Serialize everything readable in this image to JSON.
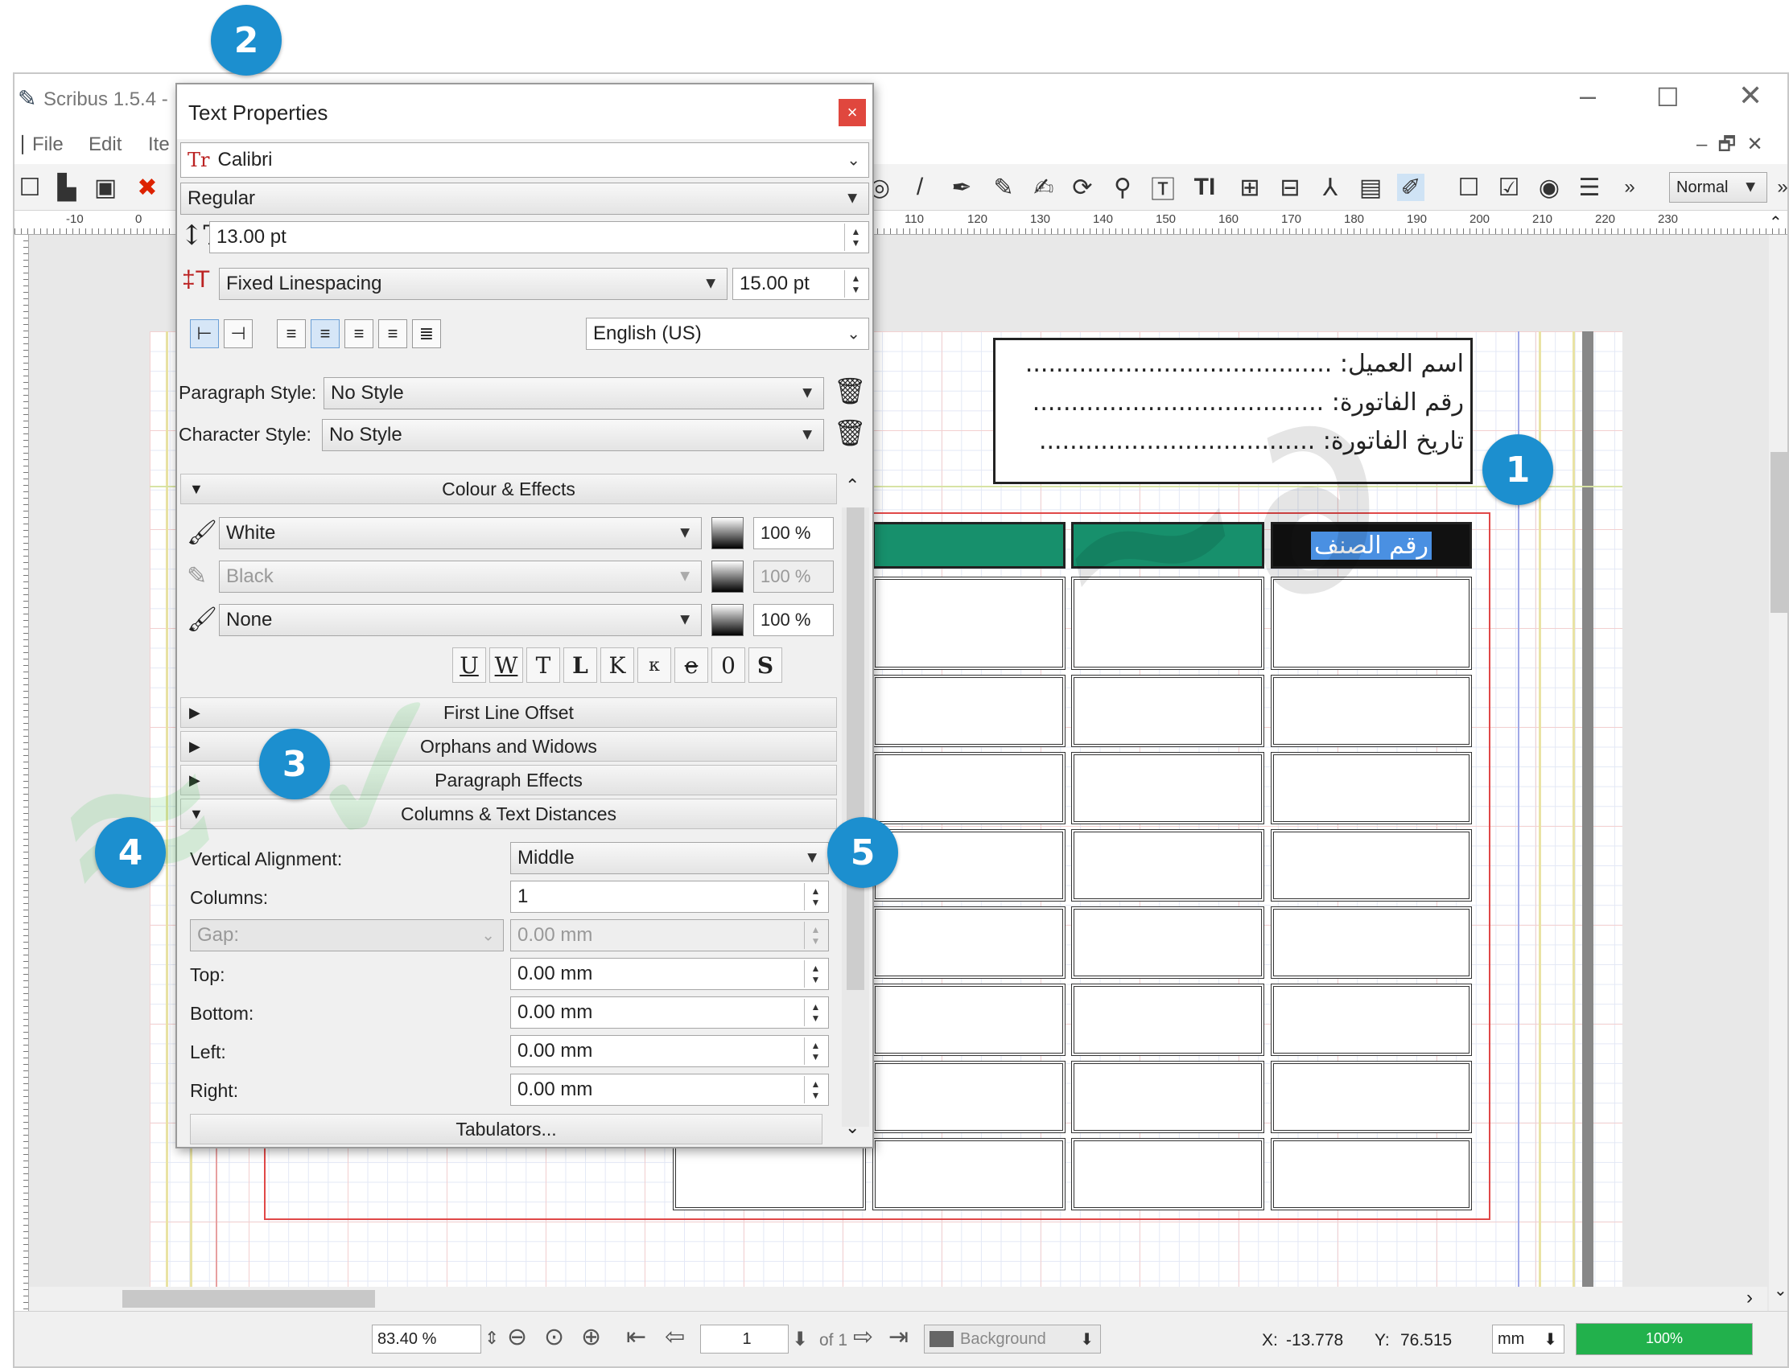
{
  "window": {
    "title": "Scribus 1.5.4 -"
  },
  "menu": {
    "file": "File",
    "edit": "Edit",
    "item": "Ite"
  },
  "toolbar": {
    "mode": "Normal"
  },
  "ruler": {
    "ticks": [
      "-10",
      "0",
      "110",
      "120",
      "130",
      "140",
      "150",
      "160",
      "170",
      "180",
      "190",
      "200",
      "210",
      "220",
      "230"
    ]
  },
  "document": {
    "info_lines": [
      "اسم العميل: ........................................",
      "رقم الفاتورة: ......................................",
      "تاريخ الفاتورة: ...................................."
    ],
    "selected_cell_text": "رقم الصنف"
  },
  "palette": {
    "title": "Text Properties",
    "close": "×",
    "font_family": "Calibri",
    "font_style": "Regular",
    "font_size": "13.00 pt",
    "linespacing_mode": "Fixed Linespacing",
    "linespacing_value": "15.00 pt",
    "language": "English (US)",
    "paragraph_style_label": "Paragraph Style:",
    "paragraph_style_value": "No Style",
    "character_style_label": "Character Style:",
    "character_style_value": "No Style",
    "sections": {
      "colour_effects": "Colour & Effects",
      "first_line_offset": "First Line Offset",
      "orphans_widows": "Orphans and Widows",
      "paragraph_effects": "Paragraph Effects",
      "columns_distances": "Columns & Text Distances"
    },
    "colours": [
      {
        "name": "White",
        "shade": "100 %"
      },
      {
        "name": "Black",
        "shade": "100 %"
      },
      {
        "name": "None",
        "shade": "100 %"
      }
    ],
    "effects": [
      "U",
      "W",
      "T",
      "L",
      "K",
      "κ",
      "e",
      "0",
      "S"
    ],
    "columns": {
      "vertical_alignment_label": "Vertical Alignment:",
      "vertical_alignment_value": "Middle",
      "columns_label": "Columns:",
      "columns_value": "1",
      "gap_label": "Gap:",
      "gap_value": "0.00 mm",
      "top_label": "Top:",
      "top_value": "0.00 mm",
      "bottom_label": "Bottom:",
      "bottom_value": "0.00 mm",
      "left_label": "Left:",
      "left_value": "0.00 mm",
      "right_label": "Right:",
      "right_value": "0.00 mm",
      "tabulators": "Tabulators..."
    }
  },
  "status": {
    "zoom": "83.40 %",
    "page": "1",
    "of_pages": "of 1",
    "layer": "Background",
    "x_label": "X:",
    "x_value": "-13.778",
    "y_label": "Y:",
    "y_value": "76.515",
    "unit": "mm",
    "progress_label": "100%",
    "progress": 1.0
  },
  "callouts": [
    "1",
    "2",
    "3",
    "4",
    "5"
  ],
  "colors": {
    "accent": "#1c8fcf",
    "cell_green": "#17906c",
    "progress_green": "#22b14c"
  }
}
